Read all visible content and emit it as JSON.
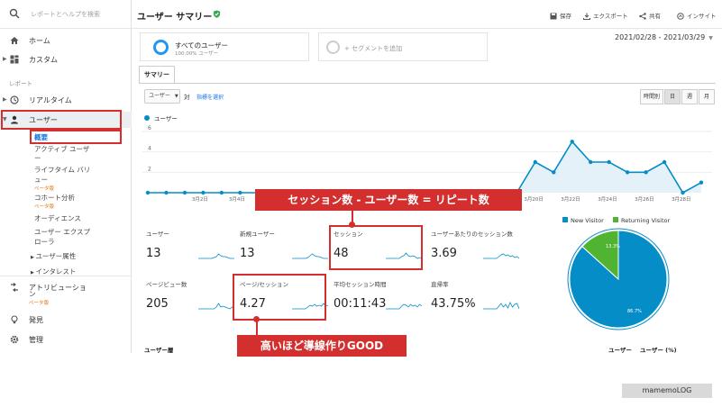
{
  "sidebar": {
    "search_placeholder": "レポートとヘルプを検索",
    "home": "ホーム",
    "custom": "カスタム",
    "section_reports": "レポート",
    "realtime": "リアルタイム",
    "users": "ユーザー",
    "sub": {
      "overview": "概要",
      "active_users_1": "アクティブ ユーザ",
      "active_users_2": "ー",
      "lifetime_1": "ライフタイム バリ",
      "lifetime_2": "ュー",
      "lifetime_beta": "ベータ版",
      "cohort": "コホート分析",
      "cohort_beta": "ベータ版",
      "audiences": "オーディエンス",
      "explorer_1": "ユーザー エクスプ",
      "explorer_2": "ローラ",
      "user_attr": "ユーザー属性",
      "interests": "インタレスト"
    },
    "attribution_1": "アトリビューショ",
    "attribution_2": "ン",
    "attribution_beta": "ベータ版",
    "discover": "発見",
    "admin": "管理"
  },
  "header": {
    "title": "ユーザー サマリー",
    "save": "保存",
    "export": "エクスポート",
    "share": "共有",
    "insights": "インサイト"
  },
  "segments": {
    "all_users": "すべてのユーザー",
    "all_users_pct": "100.00% ユーザー",
    "add_segment": "+ セグメントを追加"
  },
  "date_range": "2021/02/28 - 2021/03/29",
  "tabs": {
    "summary": "サマリー"
  },
  "controls": {
    "metric_select": "ユーザー",
    "vs": "対",
    "select_metric": "指標を選択",
    "hourly": "時間別",
    "day": "日",
    "week": "週",
    "month": "月"
  },
  "chart_data": {
    "type": "area",
    "series": [
      {
        "name": "ユーザー",
        "values": [
          0,
          0,
          0,
          0,
          0,
          0,
          0,
          0,
          0,
          0,
          0,
          0,
          0,
          0,
          0,
          0,
          0,
          0,
          0,
          0,
          0,
          3,
          2,
          5,
          3,
          3,
          2,
          2,
          3,
          0,
          1
        ]
      }
    ],
    "y_ticks": [
      "2",
      "4",
      "6"
    ],
    "ylim": [
      0,
      6
    ],
    "x_tick_labels": [
      "3月2日",
      "3月4日",
      "3月20日",
      "3月22日",
      "3月24日",
      "3月26日",
      "3月28日"
    ],
    "color": "#058dc7",
    "fill": "#e4f1f8"
  },
  "metrics": [
    {
      "label": "ユーザー",
      "value": "13"
    },
    {
      "label": "新規ユーザー",
      "value": "13"
    },
    {
      "label": "セッション",
      "value": "48"
    },
    {
      "label": "ユーザーあたりのセッション数",
      "value": "3.69"
    },
    {
      "label": "ページビュー数",
      "value": "205"
    },
    {
      "label": "ページ/セッション",
      "value": "4.27"
    },
    {
      "label": "平均セッション時間",
      "value": "00:11:43"
    },
    {
      "label": "直帰率",
      "value": "43.75%"
    }
  ],
  "pie": {
    "legend_new": "New Visitor",
    "legend_returning": "Returning Visitor",
    "new_pct_label": "86.7%",
    "returning_pct_label": "13.3%",
    "new_share": 0.867,
    "new_color": "#058dc7",
    "returning_color": "#50b432"
  },
  "table": {
    "type_header": "ユーザー層",
    "col_users": "ユーザー",
    "col_users_pct": "ユーザー (%)"
  },
  "annotations": {
    "repeat_formula": "セッション数 - ユーザー数 = リピート数",
    "good_note": "高いほど導線作りGOOD",
    "accent_color": "#d32f2f"
  },
  "watermark": "mamemoLOG"
}
